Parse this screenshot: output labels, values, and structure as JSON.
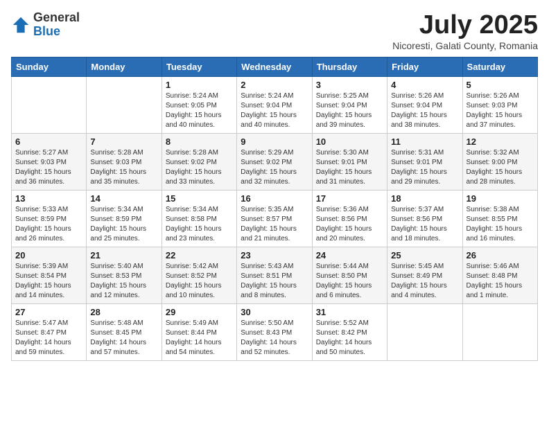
{
  "logo": {
    "general": "General",
    "blue": "Blue"
  },
  "title": {
    "month_year": "July 2025",
    "location": "Nicoresti, Galati County, Romania"
  },
  "days_of_week": [
    "Sunday",
    "Monday",
    "Tuesday",
    "Wednesday",
    "Thursday",
    "Friday",
    "Saturday"
  ],
  "weeks": [
    [
      {
        "day": "",
        "info": ""
      },
      {
        "day": "",
        "info": ""
      },
      {
        "day": "1",
        "info": "Sunrise: 5:24 AM\nSunset: 9:05 PM\nDaylight: 15 hours and 40 minutes."
      },
      {
        "day": "2",
        "info": "Sunrise: 5:24 AM\nSunset: 9:04 PM\nDaylight: 15 hours and 40 minutes."
      },
      {
        "day": "3",
        "info": "Sunrise: 5:25 AM\nSunset: 9:04 PM\nDaylight: 15 hours and 39 minutes."
      },
      {
        "day": "4",
        "info": "Sunrise: 5:26 AM\nSunset: 9:04 PM\nDaylight: 15 hours and 38 minutes."
      },
      {
        "day": "5",
        "info": "Sunrise: 5:26 AM\nSunset: 9:03 PM\nDaylight: 15 hours and 37 minutes."
      }
    ],
    [
      {
        "day": "6",
        "info": "Sunrise: 5:27 AM\nSunset: 9:03 PM\nDaylight: 15 hours and 36 minutes."
      },
      {
        "day": "7",
        "info": "Sunrise: 5:28 AM\nSunset: 9:03 PM\nDaylight: 15 hours and 35 minutes."
      },
      {
        "day": "8",
        "info": "Sunrise: 5:28 AM\nSunset: 9:02 PM\nDaylight: 15 hours and 33 minutes."
      },
      {
        "day": "9",
        "info": "Sunrise: 5:29 AM\nSunset: 9:02 PM\nDaylight: 15 hours and 32 minutes."
      },
      {
        "day": "10",
        "info": "Sunrise: 5:30 AM\nSunset: 9:01 PM\nDaylight: 15 hours and 31 minutes."
      },
      {
        "day": "11",
        "info": "Sunrise: 5:31 AM\nSunset: 9:01 PM\nDaylight: 15 hours and 29 minutes."
      },
      {
        "day": "12",
        "info": "Sunrise: 5:32 AM\nSunset: 9:00 PM\nDaylight: 15 hours and 28 minutes."
      }
    ],
    [
      {
        "day": "13",
        "info": "Sunrise: 5:33 AM\nSunset: 8:59 PM\nDaylight: 15 hours and 26 minutes."
      },
      {
        "day": "14",
        "info": "Sunrise: 5:34 AM\nSunset: 8:59 PM\nDaylight: 15 hours and 25 minutes."
      },
      {
        "day": "15",
        "info": "Sunrise: 5:34 AM\nSunset: 8:58 PM\nDaylight: 15 hours and 23 minutes."
      },
      {
        "day": "16",
        "info": "Sunrise: 5:35 AM\nSunset: 8:57 PM\nDaylight: 15 hours and 21 minutes."
      },
      {
        "day": "17",
        "info": "Sunrise: 5:36 AM\nSunset: 8:56 PM\nDaylight: 15 hours and 20 minutes."
      },
      {
        "day": "18",
        "info": "Sunrise: 5:37 AM\nSunset: 8:56 PM\nDaylight: 15 hours and 18 minutes."
      },
      {
        "day": "19",
        "info": "Sunrise: 5:38 AM\nSunset: 8:55 PM\nDaylight: 15 hours and 16 minutes."
      }
    ],
    [
      {
        "day": "20",
        "info": "Sunrise: 5:39 AM\nSunset: 8:54 PM\nDaylight: 15 hours and 14 minutes."
      },
      {
        "day": "21",
        "info": "Sunrise: 5:40 AM\nSunset: 8:53 PM\nDaylight: 15 hours and 12 minutes."
      },
      {
        "day": "22",
        "info": "Sunrise: 5:42 AM\nSunset: 8:52 PM\nDaylight: 15 hours and 10 minutes."
      },
      {
        "day": "23",
        "info": "Sunrise: 5:43 AM\nSunset: 8:51 PM\nDaylight: 15 hours and 8 minutes."
      },
      {
        "day": "24",
        "info": "Sunrise: 5:44 AM\nSunset: 8:50 PM\nDaylight: 15 hours and 6 minutes."
      },
      {
        "day": "25",
        "info": "Sunrise: 5:45 AM\nSunset: 8:49 PM\nDaylight: 15 hours and 4 minutes."
      },
      {
        "day": "26",
        "info": "Sunrise: 5:46 AM\nSunset: 8:48 PM\nDaylight: 15 hours and 1 minute."
      }
    ],
    [
      {
        "day": "27",
        "info": "Sunrise: 5:47 AM\nSunset: 8:47 PM\nDaylight: 14 hours and 59 minutes."
      },
      {
        "day": "28",
        "info": "Sunrise: 5:48 AM\nSunset: 8:45 PM\nDaylight: 14 hours and 57 minutes."
      },
      {
        "day": "29",
        "info": "Sunrise: 5:49 AM\nSunset: 8:44 PM\nDaylight: 14 hours and 54 minutes."
      },
      {
        "day": "30",
        "info": "Sunrise: 5:50 AM\nSunset: 8:43 PM\nDaylight: 14 hours and 52 minutes."
      },
      {
        "day": "31",
        "info": "Sunrise: 5:52 AM\nSunset: 8:42 PM\nDaylight: 14 hours and 50 minutes."
      },
      {
        "day": "",
        "info": ""
      },
      {
        "day": "",
        "info": ""
      }
    ]
  ]
}
